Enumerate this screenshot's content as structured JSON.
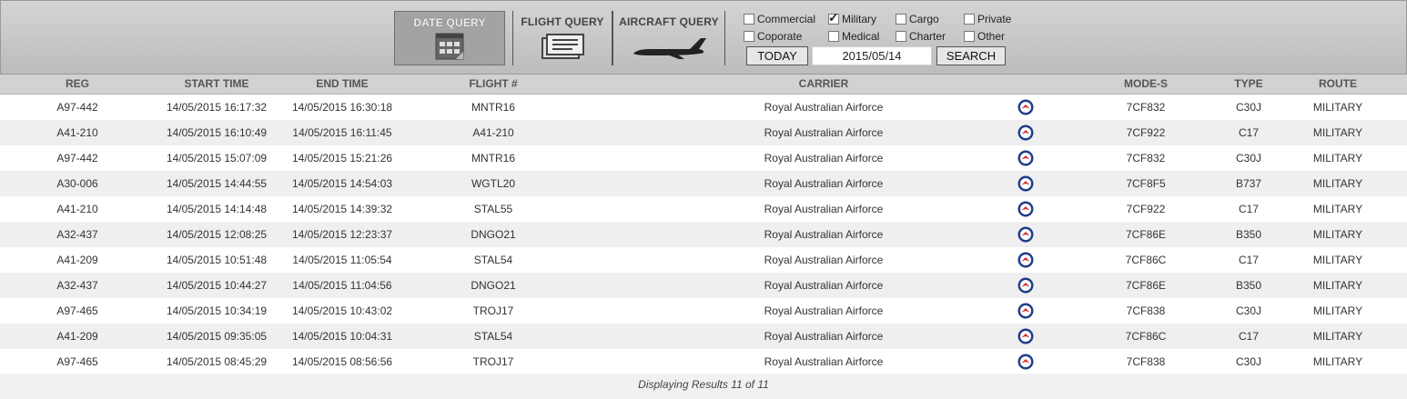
{
  "query_tabs": [
    {
      "label": "DATE QUERY",
      "icon": "calendar-icon",
      "active": true
    },
    {
      "label": "FLIGHT QUERY",
      "icon": "boarding-pass-icon",
      "active": false
    },
    {
      "label": "AIRCRAFT QUERY",
      "icon": "airplane-icon",
      "active": false
    }
  ],
  "filters": [
    {
      "label": "Commercial",
      "checked": false
    },
    {
      "label": "Military",
      "checked": true
    },
    {
      "label": "Cargo",
      "checked": false
    },
    {
      "label": "Private",
      "checked": false
    },
    {
      "label": "Coporate",
      "checked": false
    },
    {
      "label": "Medical",
      "checked": false
    },
    {
      "label": "Charter",
      "checked": false
    },
    {
      "label": "Other",
      "checked": false
    }
  ],
  "controls": {
    "today_label": "TODAY",
    "date_value": "2015/05/14",
    "search_label": "SEARCH"
  },
  "table": {
    "columns": [
      "REG",
      "START TIME",
      "END TIME",
      "FLIGHT #",
      "CARRIER",
      "MODE-S",
      "TYPE",
      "ROUTE"
    ],
    "rows": [
      {
        "reg": "A97-442",
        "start": "14/05/2015 16:17:32",
        "end": "14/05/2015 16:30:18",
        "flight": "MNTR16",
        "carrier": "Royal Australian Airforce",
        "logo": "raaf-roundel-icon",
        "modes": "7CF832",
        "type": "C30J",
        "route": "MILITARY"
      },
      {
        "reg": "A41-210",
        "start": "14/05/2015 16:10:49",
        "end": "14/05/2015 16:11:45",
        "flight": "A41-210",
        "carrier": "Royal Australian Airforce",
        "logo": "raaf-roundel-icon",
        "modes": "7CF922",
        "type": "C17",
        "route": "MILITARY"
      },
      {
        "reg": "A97-442",
        "start": "14/05/2015 15:07:09",
        "end": "14/05/2015 15:21:26",
        "flight": "MNTR16",
        "carrier": "Royal Australian Airforce",
        "logo": "raaf-roundel-icon",
        "modes": "7CF832",
        "type": "C30J",
        "route": "MILITARY"
      },
      {
        "reg": "A30-006",
        "start": "14/05/2015 14:44:55",
        "end": "14/05/2015 14:54:03",
        "flight": "WGTL20",
        "carrier": "Royal Australian Airforce",
        "logo": "raaf-roundel-icon",
        "modes": "7CF8F5",
        "type": "B737",
        "route": "MILITARY"
      },
      {
        "reg": "A41-210",
        "start": "14/05/2015 14:14:48",
        "end": "14/05/2015 14:39:32",
        "flight": "STAL55",
        "carrier": "Royal Australian Airforce",
        "logo": "raaf-roundel-icon",
        "modes": "7CF922",
        "type": "C17",
        "route": "MILITARY"
      },
      {
        "reg": "A32-437",
        "start": "14/05/2015 12:08:25",
        "end": "14/05/2015 12:23:37",
        "flight": "DNGO21",
        "carrier": "Royal Australian Airforce",
        "logo": "raaf-roundel-icon",
        "modes": "7CF86E",
        "type": "B350",
        "route": "MILITARY"
      },
      {
        "reg": "A41-209",
        "start": "14/05/2015 10:51:48",
        "end": "14/05/2015 11:05:54",
        "flight": "STAL54",
        "carrier": "Royal Australian Airforce",
        "logo": "raaf-roundel-icon",
        "modes": "7CF86C",
        "type": "C17",
        "route": "MILITARY"
      },
      {
        "reg": "A32-437",
        "start": "14/05/2015 10:44:27",
        "end": "14/05/2015 11:04:56",
        "flight": "DNGO21",
        "carrier": "Royal Australian Airforce",
        "logo": "raaf-roundel-icon",
        "modes": "7CF86E",
        "type": "B350",
        "route": "MILITARY"
      },
      {
        "reg": "A97-465",
        "start": "14/05/2015 10:34:19",
        "end": "14/05/2015 10:43:02",
        "flight": "TROJ17",
        "carrier": "Royal Australian Airforce",
        "logo": "raaf-roundel-icon",
        "modes": "7CF838",
        "type": "C30J",
        "route": "MILITARY"
      },
      {
        "reg": "A41-209",
        "start": "14/05/2015 09:35:05",
        "end": "14/05/2015 10:04:31",
        "flight": "STAL54",
        "carrier": "Royal Australian Airforce",
        "logo": "raaf-roundel-icon",
        "modes": "7CF86C",
        "type": "C17",
        "route": "MILITARY"
      },
      {
        "reg": "A97-465",
        "start": "14/05/2015 08:45:29",
        "end": "14/05/2015 08:56:56",
        "flight": "TROJ17",
        "carrier": "Royal Australian Airforce",
        "logo": "raaf-roundel-icon",
        "modes": "7CF838",
        "type": "C30J",
        "route": "MILITARY"
      }
    ]
  },
  "footer": {
    "results_text": "Displaying Results 11 of 11"
  },
  "colors": {
    "roundel_blue": "#1f3d8a",
    "roundel_red": "#d42a2a"
  }
}
